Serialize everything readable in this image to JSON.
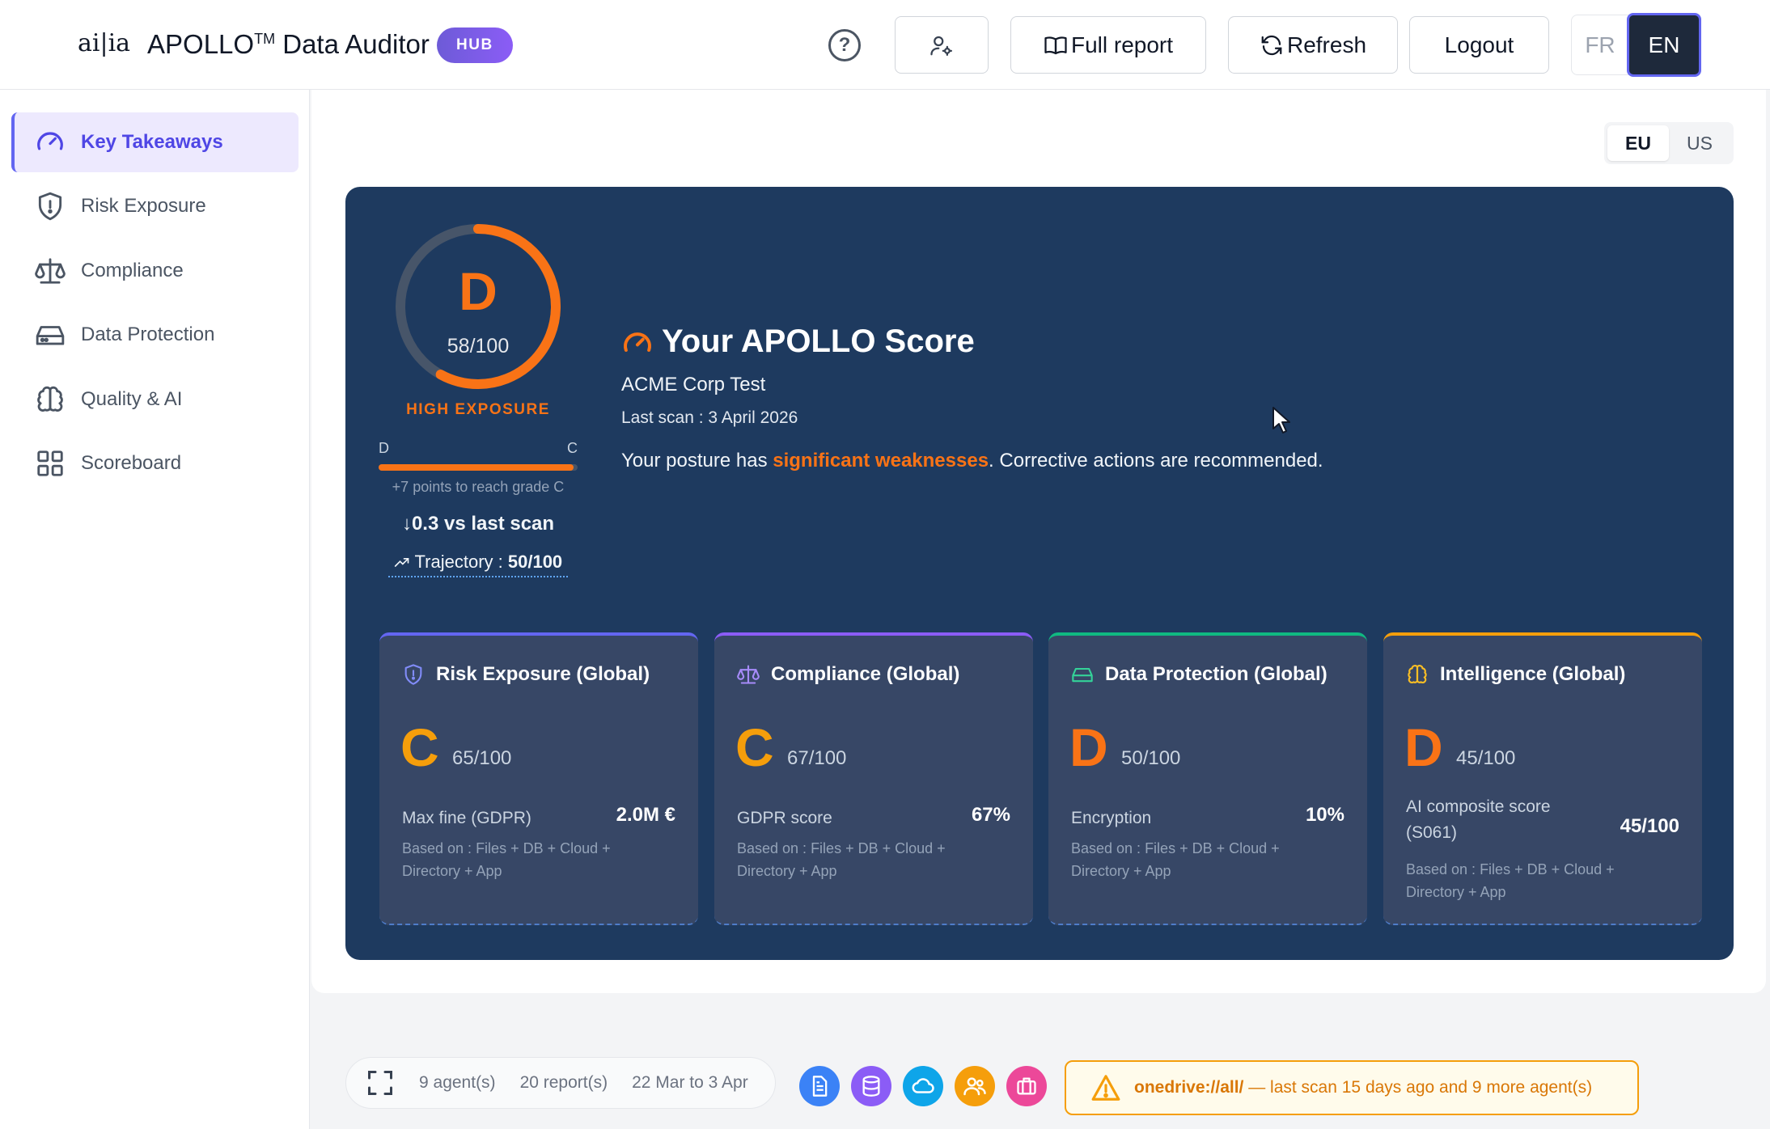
{
  "header": {
    "logo": "ai|ia",
    "app_name": "APOLLO",
    "trademark": "TM",
    "app_suffix": " Data Auditor",
    "badge": "HUB",
    "help": "?",
    "full_report": "Full report",
    "refresh": "Refresh",
    "logout": "Logout",
    "lang_fr": "FR",
    "lang_en": "EN"
  },
  "sidebar": {
    "items": [
      {
        "label": "Key Takeaways",
        "icon": "gauge-icon",
        "active": true
      },
      {
        "label": "Risk Exposure",
        "icon": "shield-icon"
      },
      {
        "label": "Compliance",
        "icon": "scale-icon"
      },
      {
        "label": "Data Protection",
        "icon": "drive-icon"
      },
      {
        "label": "Quality & AI",
        "icon": "brain-icon"
      },
      {
        "label": "Scoreboard",
        "icon": "grid-icon"
      }
    ]
  },
  "region": {
    "eu": "EU",
    "us": "US",
    "selected": "EU"
  },
  "score": {
    "grade": "D",
    "value": 58,
    "max": 100,
    "score_text": "58/100",
    "exposure_label": "HIGH EXPOSURE",
    "bar_from": "D",
    "bar_to": "C",
    "bar_progress": 0.98,
    "points_hint": "+7 points to reach grade C",
    "delta": "↓0.3 vs last scan",
    "trajectory_label": "Trajectory : ",
    "trajectory_value": "50/100",
    "title": "Your APOLLO Score",
    "org": "ACME Corp Test",
    "last_scan": "Last scan : 3 April 2026",
    "posture_pre": "Your posture has ",
    "posture_hl": "significant weaknesses",
    "posture_post": ". Corrective actions are recommended.",
    "accent": "#f97316"
  },
  "cards": [
    {
      "title": "Risk Exposure (Global)",
      "icon": "shield-icon",
      "grade": "C",
      "score": "65/100",
      "metric": "Max fine (GDPR)",
      "value": "2.0M €",
      "basis": "Based on : Files + DB + Cloud + Directory + App",
      "border": "#6366f1",
      "grade_color": "#f59e0b"
    },
    {
      "title": "Compliance (Global)",
      "icon": "scale-icon",
      "grade": "C",
      "score": "67/100",
      "metric": "GDPR score",
      "value": "67%",
      "basis": "Based on : Files + DB + Cloud + Directory + App",
      "border": "#8b5cf6",
      "grade_color": "#f59e0b"
    },
    {
      "title": "Data Protection (Global)",
      "icon": "drive-icon",
      "grade": "D",
      "score": "50/100",
      "metric": "Encryption",
      "value": "10%",
      "basis": "Based on : Files + DB + Cloud + Directory + App",
      "border": "#10b981",
      "grade_color": "#f97316"
    },
    {
      "title": "Intelligence (Global)",
      "icon": "brain-icon",
      "grade": "D",
      "score": "45/100",
      "metric": "AI composite score (S061)",
      "value": "45/100",
      "basis": "Based on : Files + DB + Cloud + Directory + App",
      "border": "#f59e0b",
      "grade_color": "#f97316"
    }
  ],
  "footer": {
    "agents": "9 agent(s)",
    "reports": "20 report(s)",
    "range": "22 Mar to 3 Apr",
    "sources": [
      {
        "icon": "file-icon",
        "color": "#3b82f6"
      },
      {
        "icon": "database-icon",
        "color": "#8b5cf6"
      },
      {
        "icon": "cloud-icon",
        "color": "#0ea5e9"
      },
      {
        "icon": "users-icon",
        "color": "#f59e0b"
      },
      {
        "icon": "app-icon",
        "color": "#ec4899"
      }
    ],
    "warning_source": "onedrive://all/",
    "warning_text": " — last scan 15 days ago and 9 more agent(s)"
  }
}
